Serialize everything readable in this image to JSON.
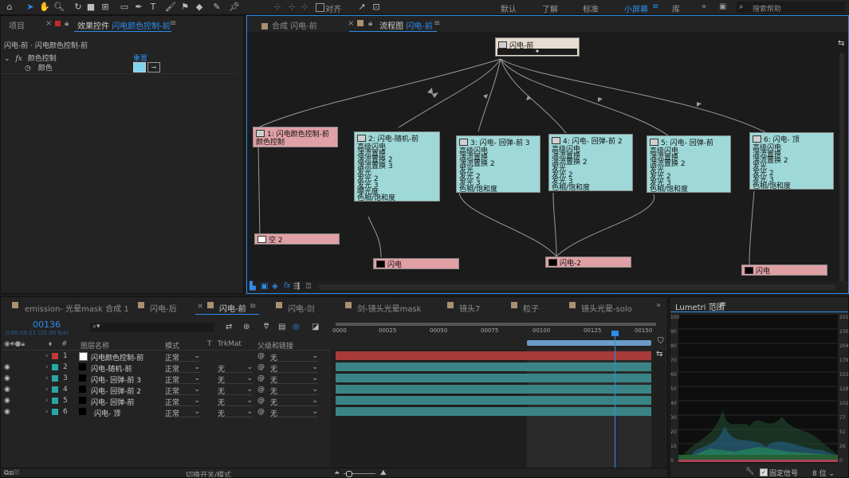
{
  "toolbar": {
    "snap_label": "对齐",
    "workspaces": [
      "默认",
      "了解",
      "标准",
      "小屏幕",
      "库"
    ],
    "active_workspace": "小屏幕",
    "search_placeholder": "搜索帮助"
  },
  "left_panel": {
    "tab_project": "项目",
    "tab_effects_prefix": "效果控件",
    "tab_effects_layer": "闪电颜色控制-前",
    "breadcrumb": "闪电-前 · 闪电颜色控制-前",
    "effect_name": "颜色控制",
    "reset_label": "重置",
    "prop_color_label": "颜色",
    "swatch_color": "#7fd4f0"
  },
  "flow_panel": {
    "tab_comp": "合成 闪电-前",
    "tab_flow_prefix": "流程图",
    "tab_flow_name": "闪电-前",
    "root_node": "闪电-前",
    "nodes": [
      {
        "title": "1: 闪电颜色控制-前",
        "body": "颜色控制"
      },
      {
        "title": "2: 闪电-随机-前",
        "body": "高级闪电\n湍流置换\n湍流置换 2\n湍流置换 3\n发光\n发光 2\n发光 3\n曝光度\n色相/饱和度"
      },
      {
        "title": "3: 闪电- 回弹-前 3",
        "body": "高级闪电\n湍流置换\n湍流置换 2\n发光\n发光 2\n发光 3\n色相/饱和度"
      },
      {
        "title": "4: 闪电- 回弹-前 2",
        "body": "高级闪电\n湍流置换\n湍流置换 2\n发光\n发光 2\n发光 3\n色相/饱和度"
      },
      {
        "title": "5: 闪电- 回弹-前",
        "body": "高级闪电\n湍流置换\n湍流置换 2\n发光\n发光 2\n发光 3\n色相/饱和度"
      },
      {
        "title": "6: 闪电- 顶",
        "body": "高级闪电\n湍流置换\n湍流置换 2\n发光\n发光 2\n发光 3\n色相/饱和度"
      }
    ],
    "sources": [
      "空 2",
      "闪电",
      "闪电-2",
      "闪电"
    ]
  },
  "timeline": {
    "tabs": [
      "emission- 光晕mask 合成 1",
      "闪电-后",
      "闪电-前",
      "闪电-剑",
      "剑-镜头光晕mask",
      "镜头7",
      "粒子",
      "镜头光晕-solo"
    ],
    "active_tab": "闪电-前",
    "timecode": "00136",
    "timecode_sub": "0:00:05:11 (25.00 fps)",
    "col_hash": "#",
    "col_layer_name": "图层名称",
    "col_mode": "模式",
    "col_t": "T",
    "col_trkmat": "TrkMat",
    "col_parent": "父级和链接",
    "ruler_labels": [
      "0000",
      "00025",
      "00050",
      "00075",
      "00100",
      "00125",
      "00150"
    ],
    "layers": [
      {
        "num": "1",
        "name": "闪电颜色控制-前",
        "mode": "正常",
        "trkmat": "",
        "parent": "无",
        "label_color": "#c03a3a",
        "bar_color": "#a83a3a"
      },
      {
        "num": "2",
        "name": "闪电-随机-前",
        "mode": "正常",
        "trkmat": "无",
        "parent": "无",
        "label_color": "#2aa6a6",
        "bar_color": "#3b8486"
      },
      {
        "num": "3",
        "name": "闪电- 回弹-前 3",
        "mode": "正常",
        "trkmat": "无",
        "parent": "无",
        "label_color": "#2aa6a6",
        "bar_color": "#3b8486"
      },
      {
        "num": "4",
        "name": "闪电- 回弹-前 2",
        "mode": "正常",
        "trkmat": "无",
        "parent": "无",
        "label_color": "#2aa6a6",
        "bar_color": "#3b8486"
      },
      {
        "num": "5",
        "name": "闪电- 回弹-前",
        "mode": "正常",
        "trkmat": "无",
        "parent": "无",
        "label_color": "#2aa6a6",
        "bar_color": "#3b8486"
      },
      {
        "num": "6",
        "name": "闪电- 顶",
        "mode": "正常",
        "trkmat": "无",
        "parent": "无",
        "label_color": "#2aa6a6",
        "bar_color": "#3b8486"
      }
    ],
    "footer_toggle": "切换开关/模式"
  },
  "lumetri": {
    "title": "Lumetri 范围",
    "left_scale": [
      "100",
      "90",
      "80",
      "70",
      "60",
      "50",
      "40",
      "30",
      "20",
      "10",
      "0"
    ],
    "right_scale": [
      "255",
      "230",
      "204",
      "179",
      "153",
      "128",
      "102",
      "77",
      "51",
      "26",
      "0"
    ],
    "clamp_label": "固定信号",
    "bits_label": "8 位"
  },
  "colors": {
    "accent": "#2d8ceb",
    "node_cyan": "#9ed8d8",
    "node_pink": "#e0a0a5"
  }
}
